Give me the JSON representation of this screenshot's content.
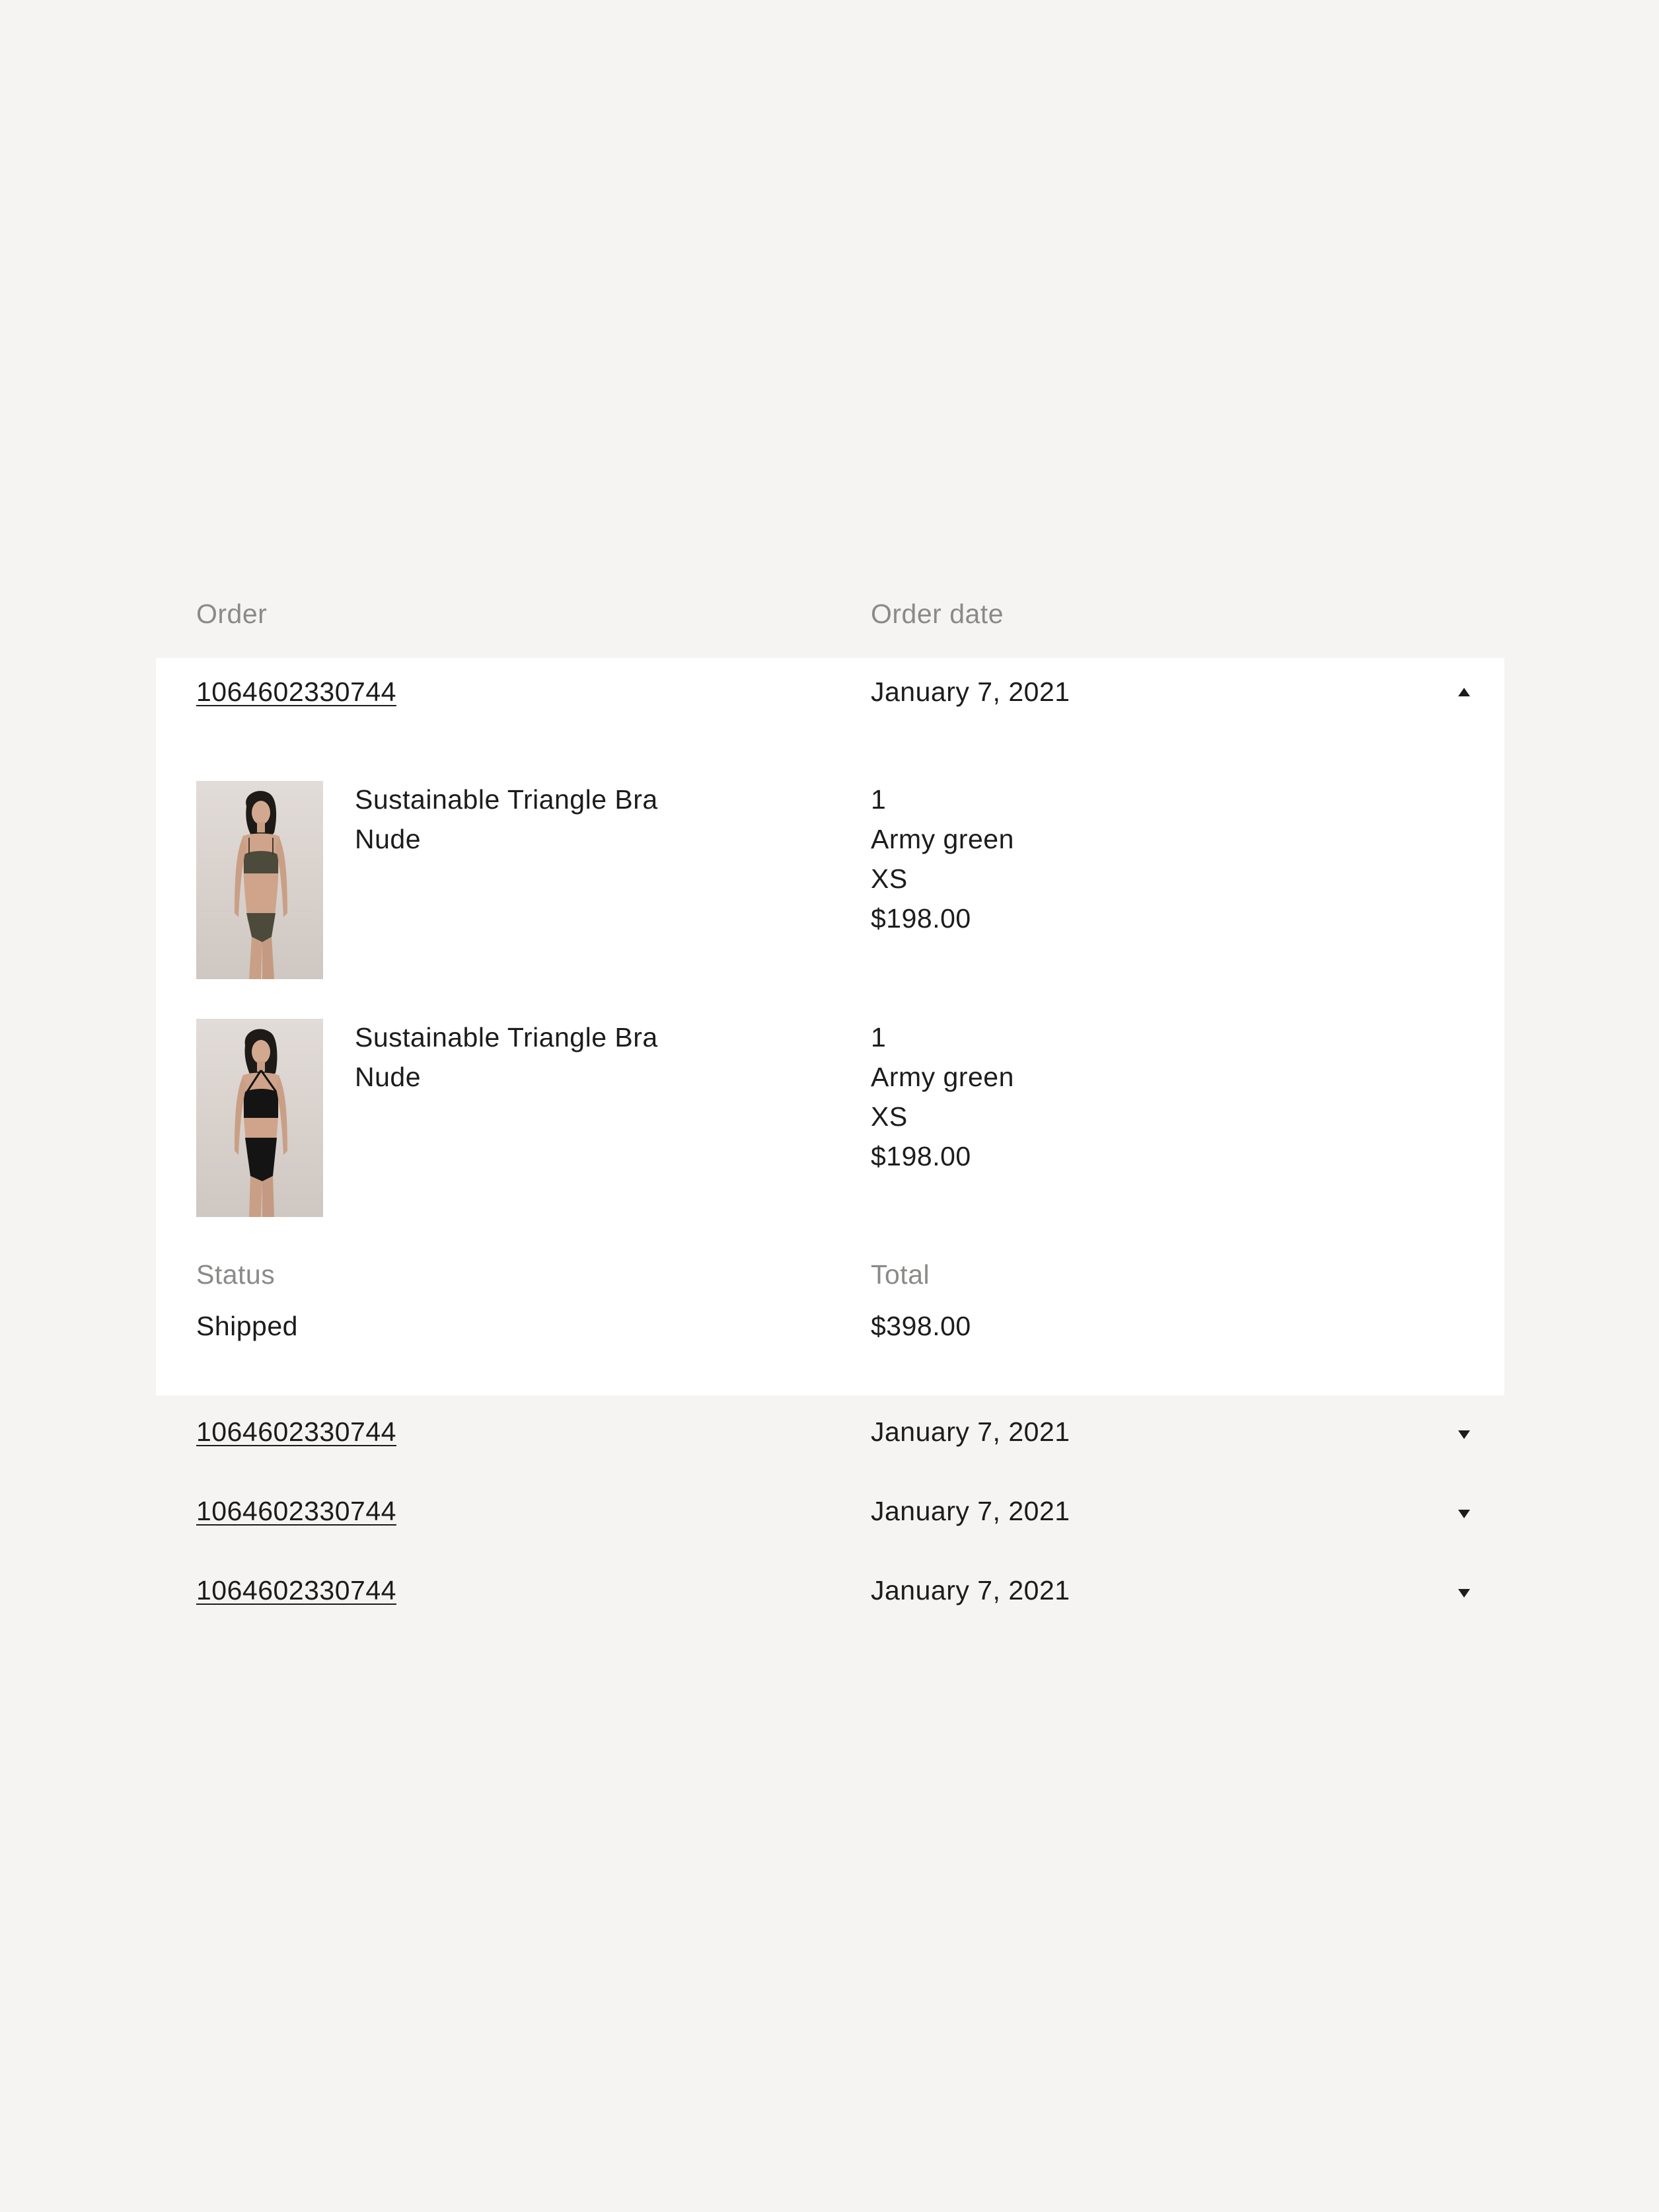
{
  "header": {
    "order_label": "Order",
    "date_label": "Order date"
  },
  "expanded_order": {
    "order_number": "1064602330744",
    "date": "January 7, 2021",
    "items": [
      {
        "name": "Sustainable Triangle Bra",
        "color_name": "Nude",
        "quantity": "1",
        "color": "Army green",
        "size": "XS",
        "price": "$198.00",
        "image": "model-army-green-set"
      },
      {
        "name": "Sustainable Triangle Bra",
        "color_name": "Nude",
        "quantity": "1",
        "color": "Army green",
        "size": "XS",
        "price": "$198.00",
        "image": "model-black-halter-set"
      }
    ],
    "status_label": "Status",
    "status_value": "Shipped",
    "total_label": "Total",
    "total_value": "$398.00",
    "toggle_icon": "chevron-up-icon"
  },
  "collapsed_orders": [
    {
      "order_number": "1064602330744",
      "date": "January 7, 2021",
      "toggle_icon": "chevron-down-icon"
    },
    {
      "order_number": "1064602330744",
      "date": "January 7, 2021",
      "toggle_icon": "chevron-down-icon"
    },
    {
      "order_number": "1064602330744",
      "date": "January 7, 2021",
      "toggle_icon": "chevron-down-icon"
    }
  ],
  "colors": {
    "page_background": "#f5f4f2",
    "card_background": "#ffffff",
    "text": "#1c1c1c",
    "muted_text": "#8a8a88"
  }
}
